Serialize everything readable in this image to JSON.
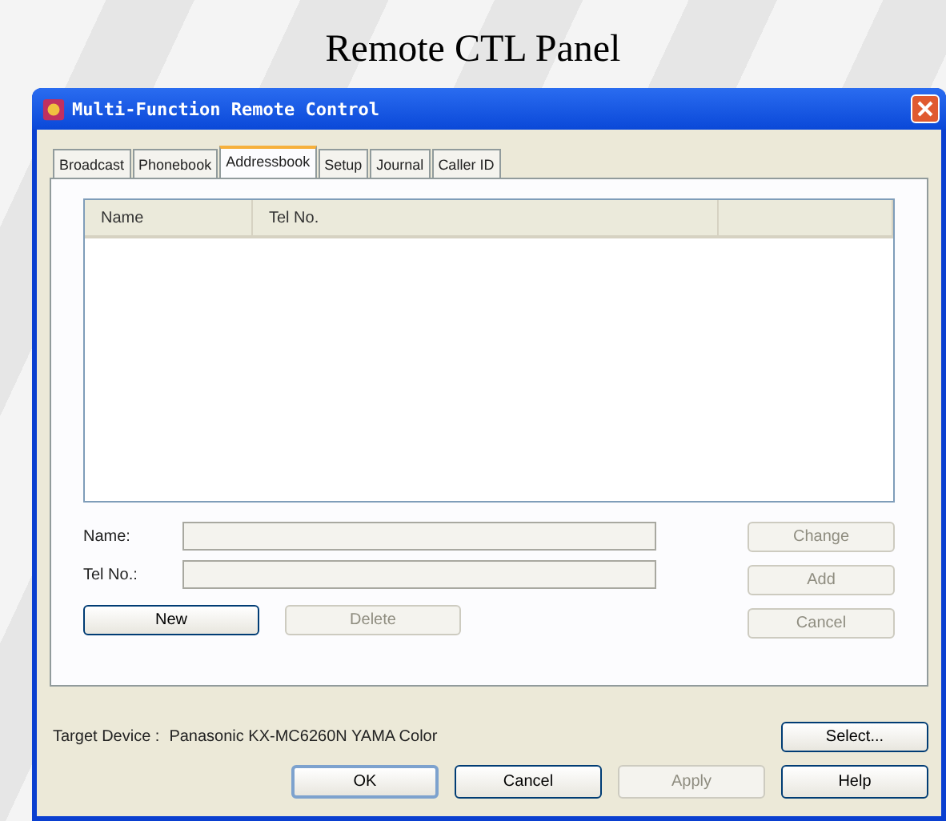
{
  "page_title": "Remote CTL Panel",
  "window": {
    "title": "Multi-Function Remote Control"
  },
  "tabs": [
    {
      "label": "Broadcast",
      "selected": false
    },
    {
      "label": "Phonebook",
      "selected": false
    },
    {
      "label": "Addressbook",
      "selected": true
    },
    {
      "label": "Setup",
      "selected": false
    },
    {
      "label": "Journal",
      "selected": false
    },
    {
      "label": "Caller ID",
      "selected": false
    }
  ],
  "list": {
    "columns": [
      "Name",
      "Tel No."
    ]
  },
  "fields": [
    {
      "label": "Name:",
      "disabled": true
    },
    {
      "label": "Tel No.:",
      "disabled": true
    }
  ],
  "side_buttons": [
    {
      "label": "Change",
      "disabled": true
    },
    {
      "label": "Add",
      "disabled": true
    },
    {
      "label": "Cancel",
      "disabled": true
    }
  ],
  "row_buttons": [
    {
      "label": "New",
      "disabled": false
    },
    {
      "label": "Delete",
      "disabled": true
    }
  ],
  "target": {
    "label": "Target Device :",
    "value": "Panasonic KX-MC6260N YAMA Color",
    "button": "Select..."
  },
  "footer_buttons": [
    {
      "label": "OK",
      "disabled": false,
      "default": true
    },
    {
      "label": "Cancel",
      "disabled": false,
      "default": false
    },
    {
      "label": "Apply",
      "disabled": true,
      "default": false
    },
    {
      "label": "Help",
      "disabled": false,
      "default": false
    }
  ]
}
